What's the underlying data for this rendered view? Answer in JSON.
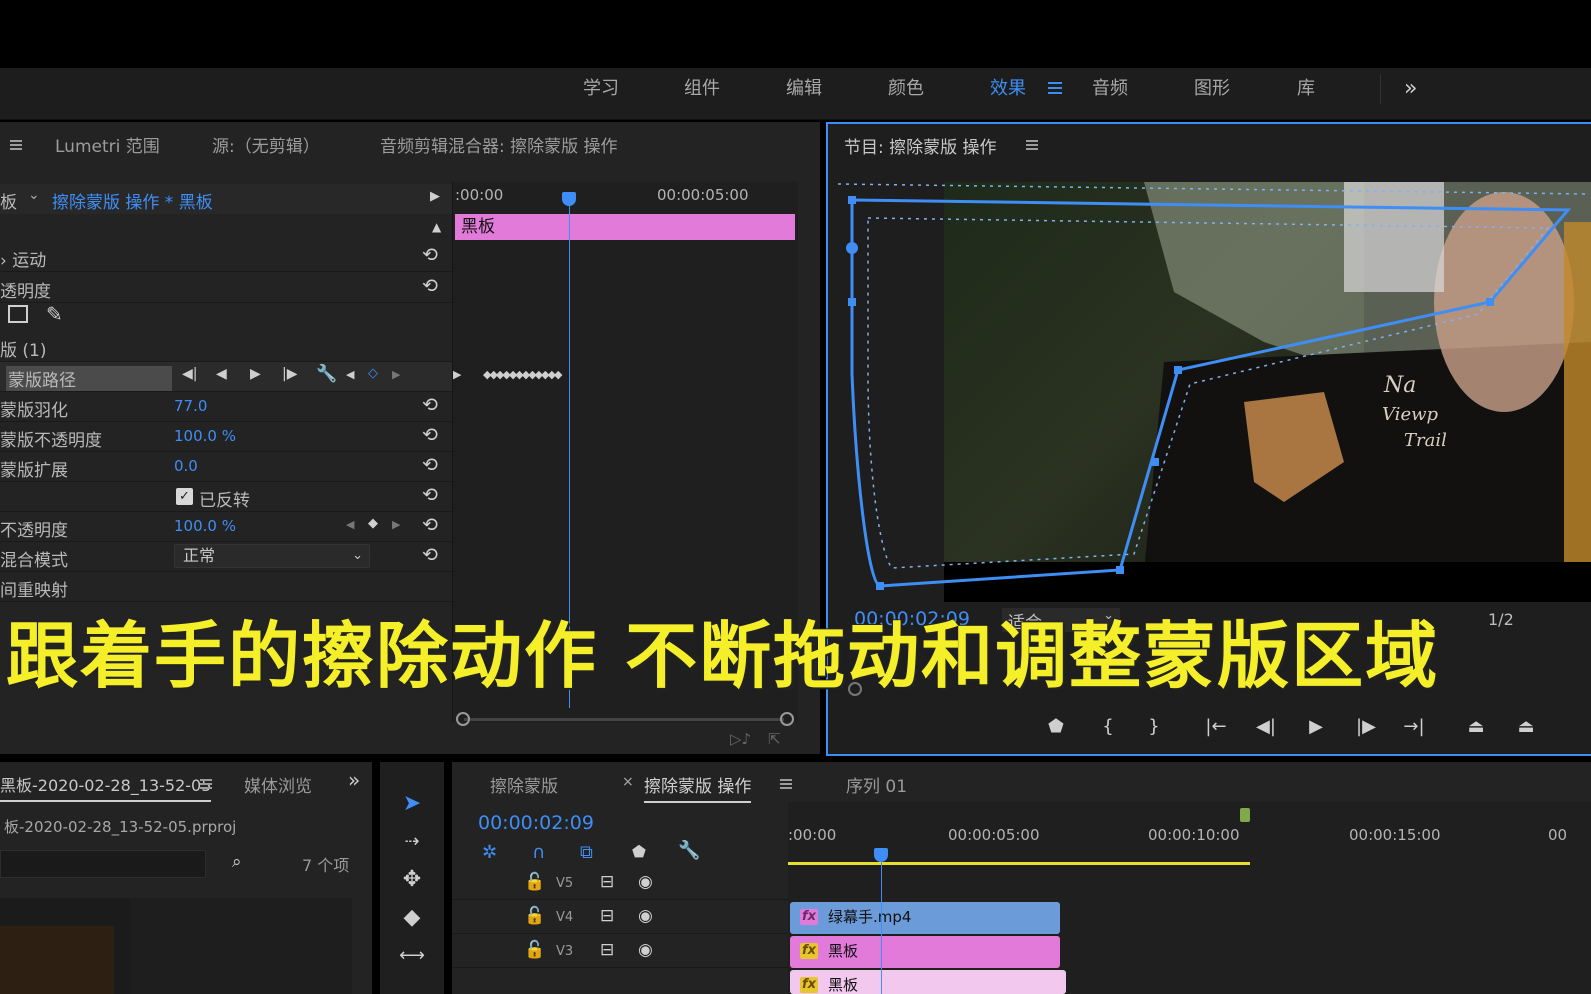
{
  "workspace_tabs": [
    "学习",
    "组件",
    "编辑",
    "颜色",
    "效果",
    "音频",
    "图形",
    "库"
  ],
  "workspace_active": "效果",
  "workspace_more": "»",
  "effect_panel": {
    "tabs": [
      "Lumetri 范围",
      "源:（无剪辑）",
      "音频剪辑混合器: 擦除蒙版 操作"
    ],
    "partial_left_label": "板",
    "sequence_clip": "擦除蒙版 操作 * 黑板",
    "rows": [
      {
        "label": "› 运动"
      },
      {
        "label": "透明度"
      },
      {
        "label": "版 (1)"
      },
      {
        "label": "蒙版路径"
      },
      {
        "label": "蒙版羽化",
        "value": "77.0"
      },
      {
        "label": "蒙版不透明度",
        "value": "100.0 %"
      },
      {
        "label": "蒙版扩展",
        "value": "0.0"
      },
      {
        "label": "已反转"
      },
      {
        "label": "不透明度",
        "value": "100.0 %"
      },
      {
        "label": "混合模式",
        "value": "正常"
      },
      {
        "label": "间重映射"
      }
    ],
    "ruler": {
      "start": ":00:00",
      "mid": "00:00:05:00"
    },
    "clip_label": "黑板"
  },
  "program_monitor": {
    "title": "节目: 擦除蒙版 操作",
    "timecode": "00:00:02:09",
    "fit": "适合",
    "resolution": "1/2"
  },
  "subtitle": "跟着手的擦除动作  不断拖动和调整蒙版区域",
  "project_panel": {
    "title": "黑板-2020-02-28_13-52-05",
    "tab2": "媒体浏览",
    "file": "板-2020-02-28_13-52-05.prproj",
    "count": "7 个项"
  },
  "timeline": {
    "tabs": [
      "擦除蒙版",
      "擦除蒙版 操作",
      "序列 01"
    ],
    "timecode": "00:00:02:09",
    "ruler": [
      ":00:00",
      "00:00:05:00",
      "00:00:10:00",
      "00:00:15:00",
      "00"
    ],
    "tracks": [
      {
        "name": "V5",
        "clip": "绿幕手.mp4"
      },
      {
        "name": "V4",
        "clip": "黑板"
      },
      {
        "name": "V3",
        "clip": "黑板"
      }
    ],
    "clip_track_v5": "绿幕手.mp4",
    "clip_track_v4": "黑板",
    "clip_track_v3": "黑板"
  },
  "colors": {
    "accent": "#3f8ef5",
    "clip_pink": "#e27ad9",
    "clip_blue": "#6b9bd8",
    "subtitle": "#f5ef2a"
  }
}
